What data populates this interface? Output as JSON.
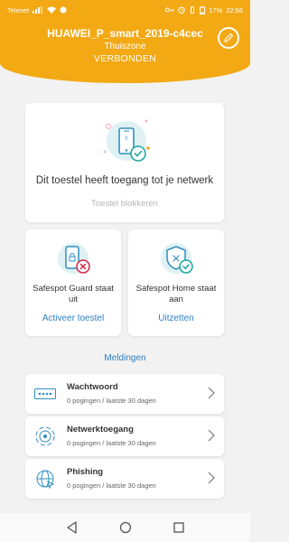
{
  "statusbar": {
    "carrier": "Telenet",
    "battery": "17%",
    "time": "22:56"
  },
  "header": {
    "device_name": "HUAWEI_P_smart_2019-c4cec",
    "location": "Thuiszone",
    "status": "VERBONDEN"
  },
  "main_card": {
    "message": "Dit toestel heeft toegang tot je netwerk",
    "block_label": "Toestel blokkeren"
  },
  "guard_card": {
    "text": "Safespot Guard staat uit",
    "action": "Activeer toestel"
  },
  "home_card": {
    "text": "Safespot Home staat aan",
    "action": "Uitzetten"
  },
  "notifications": {
    "title": "Meldingen",
    "items": [
      {
        "title": "Wachtwoord",
        "subtitle": "0 pogingen / laatste 30 dagen"
      },
      {
        "title": "Netwerktoegang",
        "subtitle": "0 pogingen / laatste 30 dagen"
      },
      {
        "title": "Phishing",
        "subtitle": "0 pogingen / laatste 30 dagen"
      }
    ]
  },
  "colors": {
    "brand": "#f3a914",
    "teal": "#1aa7a0",
    "link": "#2b7fc4",
    "danger": "#d9234b"
  },
  "icons": [
    "pencil-icon",
    "phone-check-icon",
    "phone-lock-icon",
    "shield-icon",
    "password-icon",
    "network-icon",
    "globe-icon",
    "chevron-right-icon",
    "back-icon",
    "home-icon",
    "recents-icon"
  ]
}
